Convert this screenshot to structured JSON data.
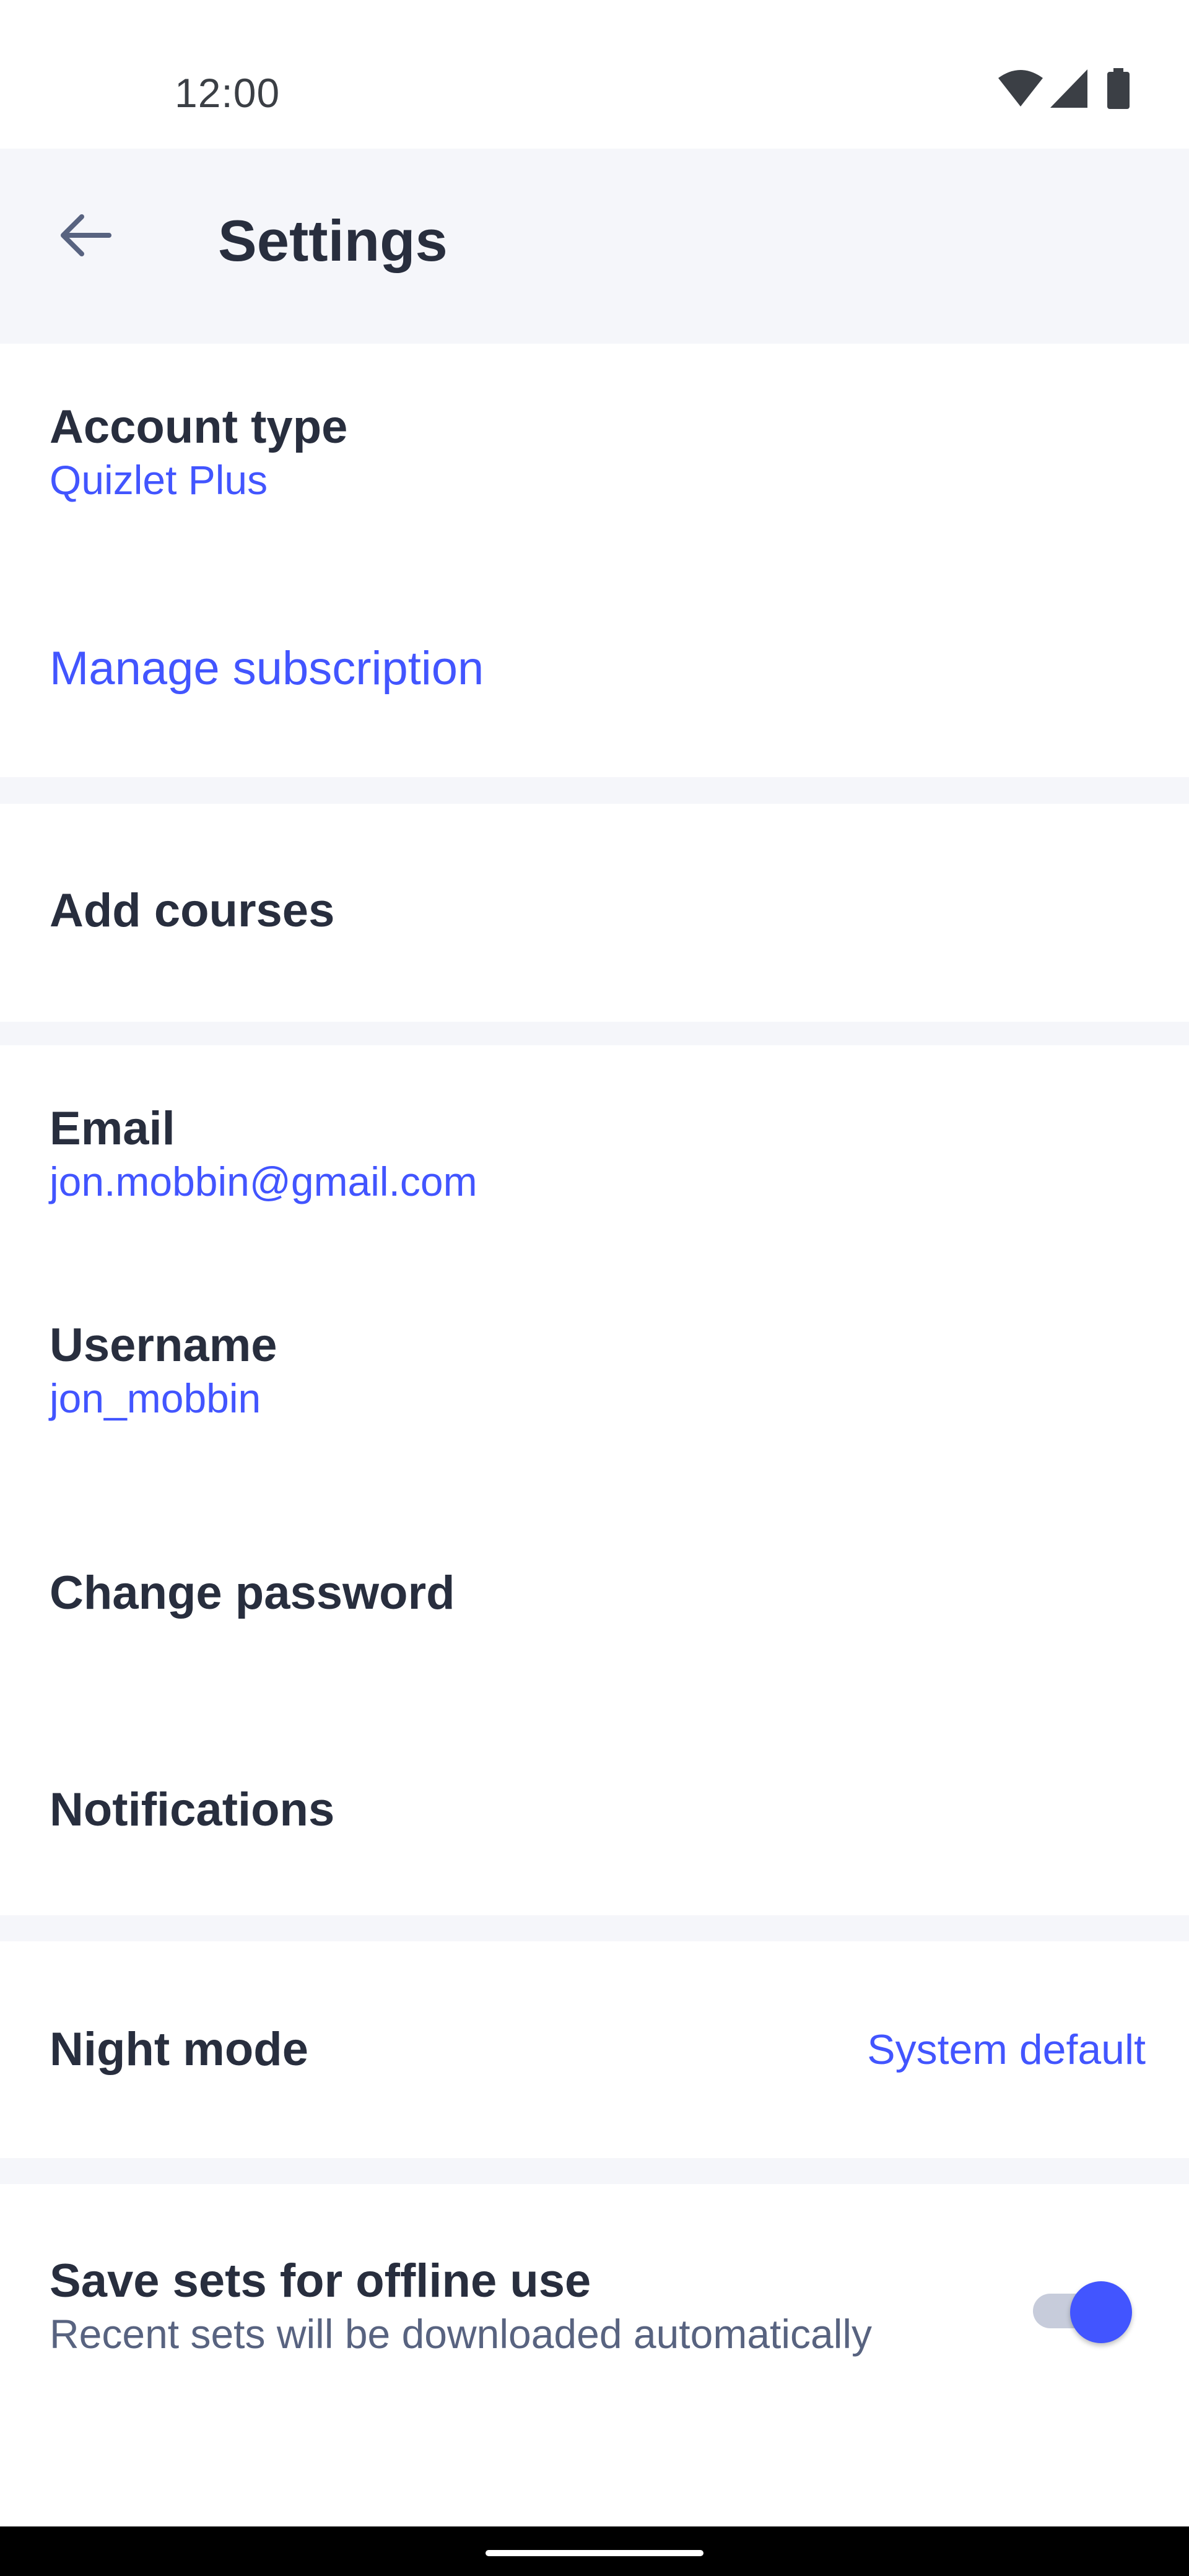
{
  "status_bar": {
    "time": "12:00",
    "icons": [
      "wifi-icon",
      "cellular-signal-icon",
      "battery-icon"
    ]
  },
  "header": {
    "title": "Settings",
    "back_icon": "arrow-back-icon"
  },
  "account": {
    "account_type_label": "Account type",
    "account_type_value": "Quizlet Plus",
    "manage_subscription_label": "Manage subscription"
  },
  "courses": {
    "add_courses_label": "Add courses"
  },
  "profile": {
    "email_label": "Email",
    "email_value": "jon.mobbin@gmail.com",
    "username_label": "Username",
    "username_value": "jon_mobbin",
    "change_password_label": "Change password",
    "notifications_label": "Notifications"
  },
  "appearance": {
    "night_mode_label": "Night mode",
    "night_mode_value": "System default"
  },
  "offline": {
    "label": "Save sets for offline use",
    "description": "Recent sets will be downloaded automatically",
    "enabled": true
  },
  "colors": {
    "accent": "#4255ff",
    "text_primary": "#282e3e",
    "text_secondary": "#586380",
    "header_bg": "#f5f6fa",
    "separator": "#f5f6fa",
    "toggle_track": "#c7ccdb"
  }
}
